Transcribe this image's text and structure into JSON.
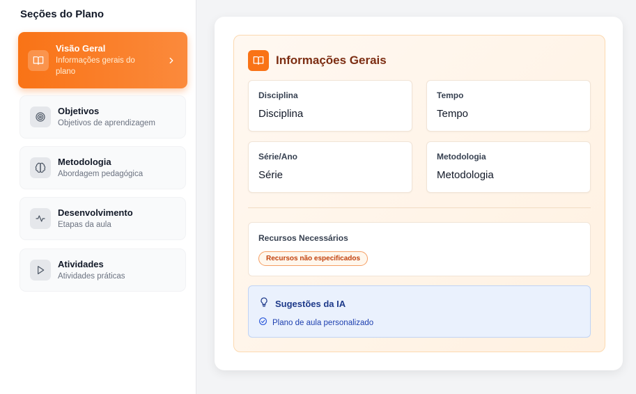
{
  "sidebar": {
    "title": "Seções do Plano",
    "items": [
      {
        "label": "Visão Geral",
        "description": "Informações gerais do plano",
        "icon": "book-open-icon",
        "active": true
      },
      {
        "label": "Objetivos",
        "description": "Objetivos de aprendizagem",
        "icon": "target-icon",
        "active": false
      },
      {
        "label": "Metodologia",
        "description": "Abordagem pedagógica",
        "icon": "brain-icon",
        "active": false
      },
      {
        "label": "Desenvolvimento",
        "description": "Etapas da aula",
        "icon": "activity-icon",
        "active": false
      },
      {
        "label": "Atividades",
        "description": "Atividades práticas",
        "icon": "play-icon",
        "active": false
      }
    ]
  },
  "panel": {
    "title": "Informações Gerais",
    "icon": "book-open-icon",
    "fields": [
      {
        "label": "Disciplina",
        "value": "Disciplina"
      },
      {
        "label": "Tempo",
        "value": "Tempo"
      },
      {
        "label": "Série/Ano",
        "value": "Série"
      },
      {
        "label": "Metodologia",
        "value": "Metodologia"
      }
    ],
    "resources": {
      "label": "Recursos Necessários",
      "badge": "Recursos não especificados"
    },
    "ai": {
      "title": "Sugestões da IA",
      "items": [
        "Plano de aula personalizado"
      ]
    }
  },
  "colors": {
    "accent": "#f97316",
    "panel_title": "#7c2d12",
    "ai_title": "#1e3a8a"
  }
}
